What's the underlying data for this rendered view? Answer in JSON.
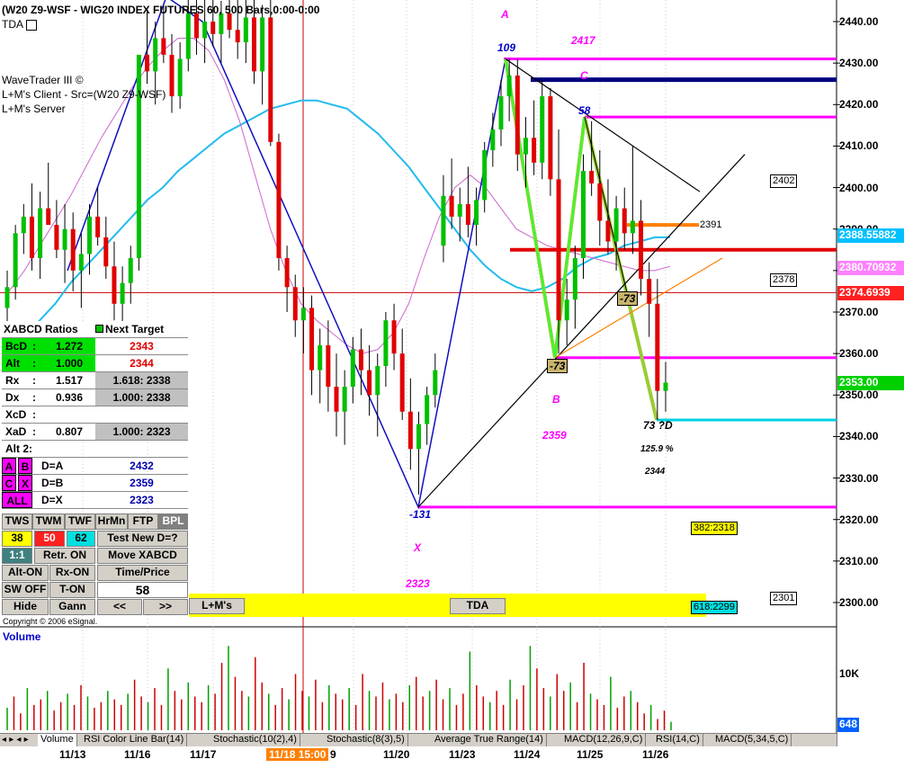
{
  "window": {
    "title": "(W20 Z9-WSF - WIG20 INDEX FUTURES 60, 500 Bars,0:00-0:00",
    "tda_label": "TDA",
    "wavetrader_lines": [
      "WaveTrader III ©",
      "L+M's Client - Src=(W20 Z9-WSF)",
      "L+M's Server"
    ],
    "copyright": "Copyright © 2006 eSignal.",
    "volume_title": "Volume"
  },
  "colors": {
    "bull": "#00c000",
    "bear": "#e00000",
    "magenta": "#ff00ff",
    "navy": "#000080",
    "cyan_ma": "#22bbee",
    "pink_ma": "#cc66cc",
    "olive": "#99cc33",
    "orange": "#ff8000"
  },
  "chart_data": {
    "type": "candlestick",
    "y_axis": {
      "range": [
        2293,
        2446
      ],
      "ticks": [
        2300,
        2310,
        2320,
        2330,
        2340,
        2350,
        2360,
        2370,
        2380,
        2390,
        2400,
        2410,
        2420,
        2430,
        2440
      ],
      "tick_labels": [
        "2300.00",
        "2310.00",
        "2320.00",
        "2330.00",
        "2340.00",
        "2350.00",
        "2360.00",
        "2370.00",
        "2380.00",
        "2390.00",
        "2400.00",
        "2410.00",
        "2420.00",
        "2430.00",
        "2440.00"
      ]
    },
    "x_axis": {
      "labels": [
        "11/13",
        "11/16",
        "11/17",
        "9",
        "11/20",
        "11/23",
        "11/24",
        "11/25",
        "11/26"
      ],
      "highlight_label": "11/18 15:00"
    },
    "price_boxes": [
      {
        "value": "2388.55882",
        "bg": "#00c0ff",
        "color": "#ffffff"
      },
      {
        "value": "2380.70932",
        "bg": "#ff80ff",
        "color": "#ffffff"
      },
      {
        "value": "2374.6939",
        "bg": "#ff2020",
        "color": "#ffffff"
      },
      {
        "value": "2353.00",
        "bg": "#00d000",
        "color": "#ffffff"
      }
    ],
    "pattern_points": [
      {
        "label": "X",
        "value": "-131",
        "price": "2323"
      },
      {
        "label": "A",
        "value": "109",
        "price": "2417"
      },
      {
        "label": "B",
        "value": "-73",
        "price": "2359"
      },
      {
        "label": "C",
        "value": "58"
      },
      {
        "label": "D",
        "value": "73 ?D"
      }
    ],
    "annotations": {
      "pct": "125.9 %",
      "d_target": "2344",
      "box_2402": "2402",
      "box_2391": "2391",
      "box_2378": "2378",
      "box_2301": "2301",
      "fib_382": "382:2318",
      "fib_618": "618:2299"
    },
    "candles": [
      {
        "o": 2371,
        "h": 2380,
        "l": 2365,
        "c": 2376
      },
      {
        "o": 2376,
        "h": 2391,
        "l": 2373,
        "c": 2389
      },
      {
        "o": 2389,
        "h": 2396,
        "l": 2384,
        "c": 2393
      },
      {
        "o": 2393,
        "h": 2401,
        "l": 2380,
        "c": 2383
      },
      {
        "o": 2383,
        "h": 2399,
        "l": 2378,
        "c": 2395
      },
      {
        "o": 2395,
        "h": 2406,
        "l": 2392,
        "c": 2391
      },
      {
        "o": 2391,
        "h": 2397,
        "l": 2383,
        "c": 2385
      },
      {
        "o": 2385,
        "h": 2396,
        "l": 2377,
        "c": 2390
      },
      {
        "o": 2390,
        "h": 2394,
        "l": 2375,
        "c": 2380
      },
      {
        "o": 2380,
        "h": 2389,
        "l": 2371,
        "c": 2384
      },
      {
        "o": 2384,
        "h": 2396,
        "l": 2379,
        "c": 2393
      },
      {
        "o": 2393,
        "h": 2400,
        "l": 2386,
        "c": 2388
      },
      {
        "o": 2388,
        "h": 2393,
        "l": 2378,
        "c": 2381
      },
      {
        "o": 2381,
        "h": 2387,
        "l": 2368,
        "c": 2372
      },
      {
        "o": 2372,
        "h": 2381,
        "l": 2364,
        "c": 2377
      },
      {
        "o": 2377,
        "h": 2386,
        "l": 2372,
        "c": 2383
      },
      {
        "o": 2383,
        "h": 2425,
        "l": 2380,
        "c": 2432
      },
      {
        "o": 2432,
        "h": 2443,
        "l": 2425,
        "c": 2428
      },
      {
        "o": 2428,
        "h": 2440,
        "l": 2420,
        "c": 2436
      },
      {
        "o": 2436,
        "h": 2444,
        "l": 2430,
        "c": 2432
      },
      {
        "o": 2432,
        "h": 2437,
        "l": 2418,
        "c": 2422
      },
      {
        "o": 2422,
        "h": 2435,
        "l": 2419,
        "c": 2431
      },
      {
        "o": 2431,
        "h": 2446,
        "l": 2428,
        "c": 2442
      },
      {
        "o": 2442,
        "h": 2446,
        "l": 2432,
        "c": 2436
      },
      {
        "o": 2436,
        "h": 2446,
        "l": 2430,
        "c": 2440
      },
      {
        "o": 2440,
        "h": 2446,
        "l": 2434,
        "c": 2437
      },
      {
        "o": 2437,
        "h": 2445,
        "l": 2430,
        "c": 2442
      },
      {
        "o": 2442,
        "h": 2446,
        "l": 2436,
        "c": 2438
      },
      {
        "o": 2438,
        "h": 2446,
        "l": 2431,
        "c": 2435
      },
      {
        "o": 2435,
        "h": 2446,
        "l": 2430,
        "c": 2441
      },
      {
        "o": 2441,
        "h": 2446,
        "l": 2425,
        "c": 2428
      },
      {
        "o": 2428,
        "h": 2444,
        "l": 2420,
        "c": 2441
      },
      {
        "o": 2441,
        "h": 2446,
        "l": 2410,
        "c": 2411
      },
      {
        "o": 2411,
        "h": 2413,
        "l": 2380,
        "c": 2383
      },
      {
        "o": 2383,
        "h": 2386,
        "l": 2370,
        "c": 2376
      },
      {
        "o": 2376,
        "h": 2379,
        "l": 2364,
        "c": 2368
      },
      {
        "o": 2368,
        "h": 2376,
        "l": 2360,
        "c": 2371
      },
      {
        "o": 2371,
        "h": 2374,
        "l": 2350,
        "c": 2356
      },
      {
        "o": 2356,
        "h": 2366,
        "l": 2348,
        "c": 2362
      },
      {
        "o": 2362,
        "h": 2368,
        "l": 2346,
        "c": 2352
      },
      {
        "o": 2352,
        "h": 2360,
        "l": 2340,
        "c": 2346
      },
      {
        "o": 2346,
        "h": 2356,
        "l": 2338,
        "c": 2352
      },
      {
        "o": 2352,
        "h": 2364,
        "l": 2348,
        "c": 2361
      },
      {
        "o": 2361,
        "h": 2366,
        "l": 2350,
        "c": 2356
      },
      {
        "o": 2356,
        "h": 2362,
        "l": 2345,
        "c": 2350
      },
      {
        "o": 2350,
        "h": 2360,
        "l": 2340,
        "c": 2357
      },
      {
        "o": 2357,
        "h": 2370,
        "l": 2352,
        "c": 2368
      },
      {
        "o": 2368,
        "h": 2372,
        "l": 2356,
        "c": 2360
      },
      {
        "o": 2360,
        "h": 2366,
        "l": 2344,
        "c": 2346
      },
      {
        "o": 2346,
        "h": 2354,
        "l": 2332,
        "c": 2337
      },
      {
        "o": 2337,
        "h": 2346,
        "l": 2326,
        "c": 2343
      },
      {
        "o": 2343,
        "h": 2352,
        "l": 2338,
        "c": 2350
      },
      {
        "o": 2350,
        "h": 2360,
        "l": 2347,
        "c": 2356
      },
      {
        "o": 2386,
        "h": 2403,
        "l": 2382,
        "c": 2398
      },
      {
        "o": 2398,
        "h": 2407,
        "l": 2390,
        "c": 2393
      },
      {
        "o": 2393,
        "h": 2400,
        "l": 2387,
        "c": 2396
      },
      {
        "o": 2396,
        "h": 2405,
        "l": 2388,
        "c": 2391
      },
      {
        "o": 2391,
        "h": 2400,
        "l": 2386,
        "c": 2397
      },
      {
        "o": 2397,
        "h": 2411,
        "l": 2394,
        "c": 2409
      },
      {
        "o": 2409,
        "h": 2418,
        "l": 2405,
        "c": 2414
      },
      {
        "o": 2414,
        "h": 2426,
        "l": 2410,
        "c": 2422
      },
      {
        "o": 2422,
        "h": 2431,
        "l": 2416,
        "c": 2427
      },
      {
        "o": 2427,
        "h": 2431,
        "l": 2404,
        "c": 2408
      },
      {
        "o": 2408,
        "h": 2417,
        "l": 2400,
        "c": 2412
      },
      {
        "o": 2412,
        "h": 2421,
        "l": 2403,
        "c": 2406
      },
      {
        "o": 2406,
        "h": 2426,
        "l": 2402,
        "c": 2422
      },
      {
        "o": 2422,
        "h": 2424,
        "l": 2398,
        "c": 2402
      },
      {
        "o": 2402,
        "h": 2414,
        "l": 2360,
        "c": 2368
      },
      {
        "o": 2368,
        "h": 2378,
        "l": 2362,
        "c": 2373
      },
      {
        "o": 2373,
        "h": 2386,
        "l": 2366,
        "c": 2383
      },
      {
        "o": 2383,
        "h": 2408,
        "l": 2378,
        "c": 2404
      },
      {
        "o": 2404,
        "h": 2416,
        "l": 2398,
        "c": 2401
      },
      {
        "o": 2401,
        "h": 2409,
        "l": 2386,
        "c": 2392
      },
      {
        "o": 2392,
        "h": 2402,
        "l": 2384,
        "c": 2387
      },
      {
        "o": 2387,
        "h": 2398,
        "l": 2380,
        "c": 2395
      },
      {
        "o": 2395,
        "h": 2400,
        "l": 2385,
        "c": 2389
      },
      {
        "o": 2389,
        "h": 2410,
        "l": 2384,
        "c": 2392
      },
      {
        "o": 2392,
        "h": 2397,
        "l": 2374,
        "c": 2378
      },
      {
        "o": 2378,
        "h": 2382,
        "l": 2364,
        "c": 2372
      },
      {
        "o": 2372,
        "h": 2378,
        "l": 2344,
        "c": 2351
      },
      {
        "o": 2351,
        "h": 2358,
        "l": 2346,
        "c": 2353
      }
    ],
    "volume": {
      "axis_label": "10K",
      "current": "648",
      "bars": [
        8,
        12,
        6,
        15,
        9,
        11,
        14,
        7,
        10,
        13,
        9,
        16,
        12,
        8,
        10,
        14,
        11,
        9,
        13,
        18,
        12,
        10,
        15,
        9,
        22,
        14,
        11,
        17,
        12,
        10,
        16,
        13,
        24,
        30,
        19,
        14,
        12,
        26,
        17,
        13,
        9,
        15,
        11,
        20,
        14,
        12,
        18,
        10,
        16,
        13,
        11,
        15,
        9,
        20,
        14,
        12,
        17,
        11,
        13,
        10,
        16,
        19,
        12,
        14,
        18,
        11,
        15,
        9,
        13,
        28,
        16,
        12,
        10,
        14,
        9,
        18,
        11,
        16,
        30,
        22,
        15,
        12,
        20,
        14,
        17,
        10,
        24,
        13,
        11,
        9,
        19,
        8,
        12,
        14,
        10,
        6,
        9,
        4,
        7,
        3
      ]
    },
    "moving_averages": [
      {
        "name": "cyan",
        "values": [
          2360,
          2364,
          2368,
          2372,
          2377,
          2381,
          2385,
          2389,
          2393,
          2397,
          2400,
          2404,
          2407,
          2410,
          2413,
          2415,
          2417,
          2419,
          2420,
          2421,
          2421,
          2420,
          2419,
          2416,
          2413,
          2409,
          2405,
          2400,
          2395,
          2390,
          2385,
          2381,
          2378,
          2376,
          2375,
          2376,
          2378,
          2381,
          2383,
          2384,
          2386,
          2387,
          2388,
          2388
        ]
      },
      {
        "name": "pink",
        "values": [
          2375,
          2380,
          2386,
          2392,
          2398,
          2405,
          2412,
          2418,
          2424,
          2429,
          2433,
          2436,
          2436,
          2433,
          2426,
          2416,
          2403,
          2390,
          2380,
          2372,
          2368,
          2365,
          2362,
          2360,
          2361,
          2365,
          2372,
          2383,
          2393,
          2400,
          2403,
          2400,
          2395,
          2390,
          2388,
          2386,
          2385,
          2384,
          2383,
          2382,
          2381,
          2380,
          2380,
          2381
        ]
      }
    ]
  },
  "xabcd_panel": {
    "header": {
      "col1": "XABCD Ratios",
      "col2": "Next Target"
    },
    "rows": [
      {
        "l1": "BcD",
        "l2": ":",
        "v": "1.272",
        "t": "2343",
        "bg": "#00e000"
      },
      {
        "l1": "Alt",
        "l2": ":",
        "v": "1.000",
        "t": "2344",
        "bg": "#00e000"
      },
      {
        "l1": "Rx",
        "l2": ":",
        "v": "1.517",
        "t": "1.618: 2338",
        "bg": "#ffffff",
        "tbg": "#c0c0c0"
      },
      {
        "l1": "Dx",
        "l2": ":",
        "v": "0.936",
        "t": "1.000: 2338",
        "bg": "#ffffff",
        "tbg": "#c0c0c0"
      },
      {
        "l1": "XcD",
        "l2": ":",
        "v": "",
        "t": "",
        "bg": "#ffffff"
      },
      {
        "l1": "XaD",
        "l2": ":",
        "v": "0.807",
        "t": "1.000: 2323",
        "bg": "#ffffff",
        "tbg": "#c0c0c0"
      }
    ],
    "alt2": "Alt 2:",
    "pairs": [
      {
        "a": "A",
        "b": "B",
        "eq": "D=A",
        "val": "2432"
      },
      {
        "a": "C",
        "b": "X",
        "eq": "D=B",
        "val": "2359"
      },
      {
        "a": "ALL",
        "b": "",
        "eq": "D=X",
        "val": "2323"
      }
    ],
    "tf_buttons": [
      "TWS",
      "TWM",
      "TWF",
      "HrMn",
      "FTP",
      "BPL"
    ],
    "vals": {
      "a": "38",
      "b": "50",
      "c": "62",
      "test": "Test New D=?"
    },
    "row_retr": {
      "ratio": "1:1",
      "retr": "Retr. ON",
      "move": "Move XABCD"
    },
    "row_alt": {
      "alt": "Alt-ON",
      "rx": "Rx-ON",
      "tp": "Time/Price"
    },
    "row_sw": {
      "sw": "SW OFF",
      "t": "T-ON",
      "val": "58"
    },
    "row_nav": {
      "hide": "Hide",
      "gann": "Gann",
      "prev": "<<",
      "next": ">>",
      "lm": "L+M's",
      "tda": "TDA"
    }
  },
  "tabs": [
    "Volume",
    "RSI Color Line Bar(14)",
    "Stochastic(10(2),4)",
    "Stochastic(8(3),5)",
    "Average True Range(14)",
    "MACD(12,26,9,C)",
    "RSI(14,C)",
    "MACD(5,34,5,C)"
  ]
}
